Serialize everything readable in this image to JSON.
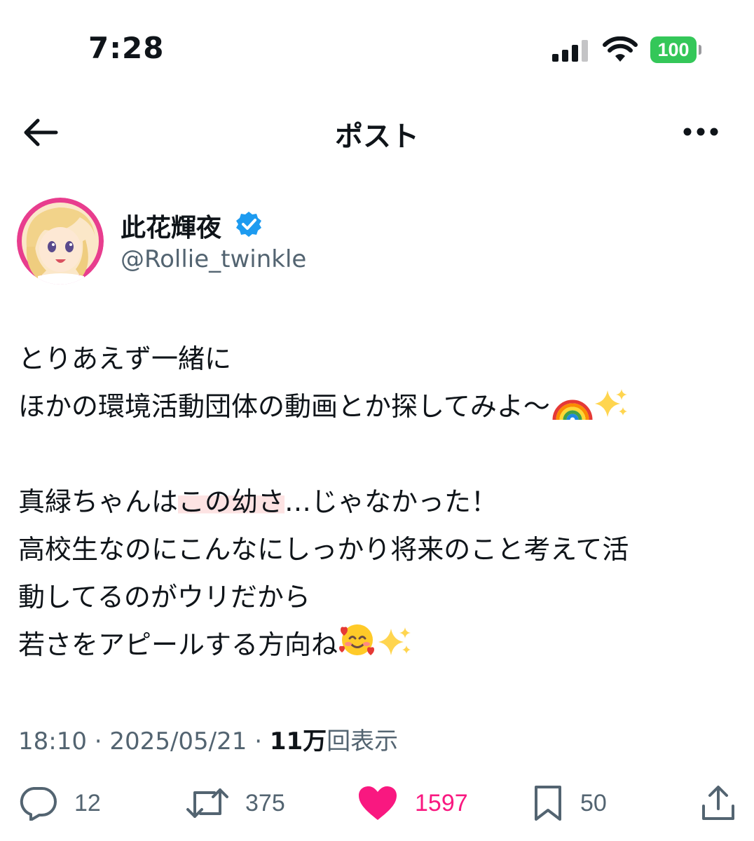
{
  "status_bar": {
    "time": "7:28",
    "battery": "100",
    "battery_color": "#34c759"
  },
  "header": {
    "title": "ポスト",
    "back_icon": "arrow-left-icon",
    "more_icon": "more-horizontal-icon"
  },
  "profile": {
    "display_name": "此花輝夜",
    "handle": "@Rollie_twinkle",
    "verified": true,
    "verified_color": "#1d9bf0",
    "avatar_ring_color": "#e83d8e"
  },
  "tweet": {
    "lines": [
      "とりあえず一緒に",
      "ほかの環境活動団体の動画とか探してみよ〜",
      "",
      "真緑ちゃんは",
      "この幼さ",
      "…じゃなかった！",
      "高校生なのにこんなにしっかり将来のこと考えて活",
      "動してるのがウリだから",
      "若さをアピールする方向ね"
    ]
  },
  "meta": {
    "time": "18:10",
    "separator": " · ",
    "date": "2025/05/21",
    "views_count": "11万",
    "views_label": "回表示"
  },
  "actions": {
    "replies": "12",
    "reposts": "375",
    "likes": "1597",
    "bookmarks": "50",
    "like_color": "#f91880"
  }
}
